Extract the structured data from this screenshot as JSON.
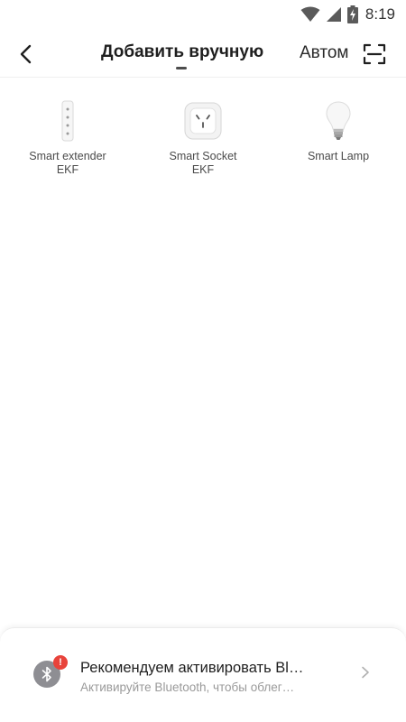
{
  "status_bar": {
    "time": "8:19",
    "icons": [
      "wifi-icon",
      "signal-icon",
      "battery-charging-icon"
    ]
  },
  "header": {
    "back_icon": "back-arrow-icon",
    "title": "Добавить вручную",
    "auto_tab": "Автом",
    "scan_icon": "scan-icon"
  },
  "devices": [
    {
      "label": "Smart extender EKF",
      "icon": "power-strip-icon"
    },
    {
      "label": "Smart Socket EKF",
      "icon": "smart-socket-icon"
    },
    {
      "label": "Smart Lamp",
      "icon": "light-bulb-icon"
    }
  ],
  "bluetooth_prompt": {
    "icon": "bluetooth-icon",
    "badge": "!",
    "title": "Рекомендуем активировать Bl…",
    "subtitle": "Активируйте Bluetooth, чтобы облег…",
    "chevron_icon": "chevron-right-icon"
  }
}
